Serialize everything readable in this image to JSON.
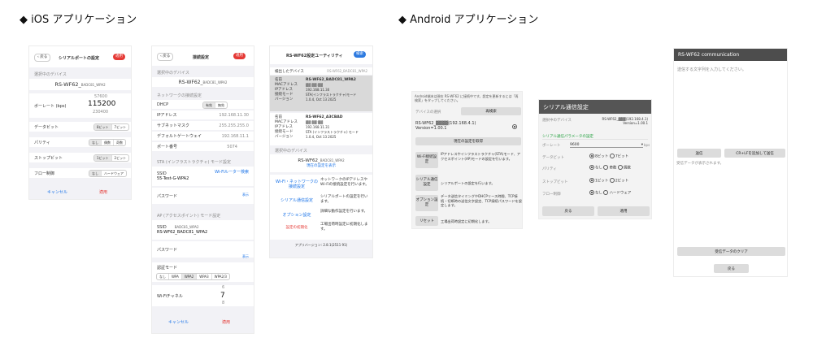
{
  "headers": {
    "ios": "◆ iOS アプリケーション",
    "android": "◆ Android アプリケーション"
  },
  "s1": {
    "back": "戻る",
    "title": "シリアルポートの設定",
    "apply": "適用",
    "section": "選択中のデバイス",
    "device": "RS-WF62_",
    "baud_label": "ボーレート (bps)",
    "baud_prev": "57600",
    "baud_value": "115200",
    "baud_next": "230400",
    "databit_label": "データビット",
    "databit_opts": [
      "8ビット",
      "7ビット"
    ],
    "parity_label": "パリティ",
    "parity_opts": [
      "なし",
      "偶数",
      "奇数"
    ],
    "stopbit_label": "ストップビット",
    "stopbit_opts": [
      "1ビット",
      "2ビット"
    ],
    "flow_label": "フロー制御",
    "flow_opts": [
      "なし",
      "ハードウェア"
    ],
    "cancel": "キャンセル",
    "apply2": "適用"
  },
  "s2": {
    "back": "戻る",
    "title": "接続設定",
    "apply": "適用",
    "section1": "選択中のデバイス",
    "device": "RS-WF62_",
    "section2": "ネットワークの接続設定",
    "dhcp_label": "DHCP",
    "dhcp_opts": [
      "有効",
      "無効"
    ],
    "ip_label": "IPアドレス",
    "ip_value": "192.168.11.30",
    "mask_label": "サブネットマスク",
    "mask_value": "255.255.255.0",
    "gw_label": "デフォルトゲートウェイ",
    "gw_value": "192.168.11.1",
    "port_label": "ポート番号",
    "port_value": "5074",
    "section3": "STA (インフラストラクチャ) モード設定",
    "ssid_label": "SSID",
    "ssid_link": "Wi-Fiルーター検索",
    "ssid_value": "55-Test-G-WPA2",
    "pw_label": "パスワード",
    "show": "表示",
    "section4": "AP (アクセスポイント) モード設定",
    "ap_ssid_label": "SSID",
    "ap_ssid_value": "RS-WF62_BADC81_WPA2",
    "ap_pw_label": "パスワード",
    "show2": "表示",
    "auth_label": "認証モード",
    "auth_opts": [
      "なし",
      "WPA",
      "WPA2",
      "WPA3",
      "WPA2/3"
    ],
    "ch_label": "Wi-Fiチャネル",
    "ch_prev": "6",
    "ch_value": "7",
    "ch_next": "8",
    "cancel": "キャンセル",
    "apply2": "適用"
  },
  "s3": {
    "title": "RS-WF62設定ユーティリティ",
    "search": "検索",
    "detected_label": "検出したデバイス",
    "dev1": {
      "name_label": "名前",
      "name": "RS-WF62_BADC81_WPA2",
      "mac_label": "MACアドレス",
      "ip_label": "IPアドレス",
      "ip": "192.168.11.30",
      "mode_label": "接続モード",
      "mode": "STA(インフラストラクチャ)モード",
      "ver_label": "バージョン",
      "ver": "1.0.4, Oct 13 2025"
    },
    "dev2": {
      "name_label": "名前",
      "name": "RS-WF62_A3CBAD",
      "mac_label": "MACアドレス",
      "ip_label": "IPアドレス",
      "ip": "192.168.11.31",
      "mode_label": "接続モード",
      "mode": "STA (インフラストラクチャ) モード",
      "ver_label": "バージョン",
      "ver": "1.0.4, Oct 13 2025"
    },
    "selected_label": "選択中のデバイス",
    "selected": "RS-WF62_",
    "show_current": "現在の設定を表示",
    "menu": [
      {
        "btn": "Wi-Fi・ネットワークの接続設定",
        "desc": "ネットワークのIPアドレスやWi-Fiの接続設定を行います。"
      },
      {
        "btn": "シリアル通信設定",
        "desc": "シリアルポートの設定を行います。"
      },
      {
        "btn": "オプション設定",
        "desc": "詳細な動作設定を行います。"
      },
      {
        "btn": "設定の初期化",
        "desc": "工場出荷時設定に初期化します。"
      }
    ],
    "version": "アプリバージョン: 2.8.1(2511 91)"
  },
  "a1": {
    "note": "Android端末は現在 RS-WF62 に接続中です。設定を更新するには「再検索」をタップしてください。",
    "devsel_label": "デバイスの選択",
    "rescan": "再検索",
    "device": "RS-WF62_",
    "device_ip": "(192.168.4.1)",
    "device_ver": "Version=1.00.1",
    "show_current": "現在の設定を取得",
    "menu": [
      {
        "btn": "Wi-Fi接続設定",
        "desc": "IPアドレスやインフラストラクチャ(STA)モード、アクセスポイント(AP)モードの設定を行います。"
      },
      {
        "btn": "シリアル通信設定",
        "desc": "シリアルポートの設定を行います。"
      },
      {
        "btn": "オプション設定",
        "desc": "データ送信タイミングやDHCPリース時間、TCP接続・切断時の送信文字設定、TCP接続パスワードを設定します。"
      },
      {
        "btn": "リセット",
        "desc": "工場出荷時設定に初期化します。"
      }
    ]
  },
  "a2": {
    "title": "シリアル通信設定",
    "dev_label": "選択中のデバイス",
    "device": "RS-WF62_",
    "device_ip": "(192.168.4.1)",
    "device_ver": "Version=1.00.1",
    "params_label": "シリアル通信パラメータの設定",
    "baud_label": "ボーレート",
    "baud_value": "9600",
    "baud_unit": "bps",
    "data_label": "データビット",
    "data_opts": [
      "8ビット",
      "7ビット"
    ],
    "parity_label": "パリティ",
    "parity_opts": [
      "なし",
      "奇数",
      "偶数"
    ],
    "stop_label": "ストップビット",
    "stop_opts": [
      "1ビット",
      "2ビット"
    ],
    "flow_label": "フロー制御",
    "flow_opts": [
      "なし",
      "ハードウェア"
    ],
    "back": "戻る",
    "apply": "適用"
  },
  "a3": {
    "title": "RS-WF62 communication",
    "input_placeholder": "送信する文字列を入力してください。",
    "send": "送信",
    "send_crlf": "CR+LFを追加して送信",
    "received": "受信データが表示されます。",
    "clear": "受信データのクリア",
    "back": "戻る"
  }
}
